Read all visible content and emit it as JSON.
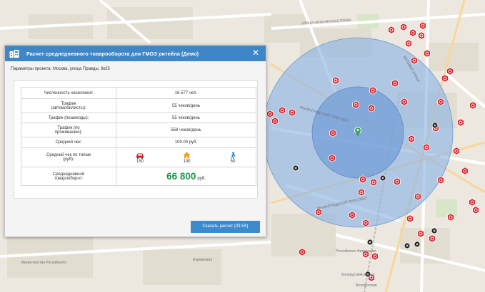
{
  "dialog": {
    "title": "Расчет среднедневного товарооборота для ГМОЗ ритейла (Демо)",
    "close_symbol": "✕",
    "params": "Параметры проекта: Москва, улица Правды, 8к35",
    "download_label": "Скачать расчет (33.5X)"
  },
  "table": {
    "population_label": "Численность населения:",
    "population_value": "16 577 чел.",
    "traffic_cars_label_1": "Трафик",
    "traffic_cars_label_2": "(автомобилисты):",
    "traffic_cars_value": "55 чеков/день",
    "traffic_ped_label": "Трафик (пешеходы):",
    "traffic_ped_value": "55 чеков/день",
    "traffic_res_label_1": "Трафик (по",
    "traffic_res_label_2": "проживанию):",
    "traffic_res_value": "558 чеков/день",
    "avg_check_label": "Средний чек:",
    "avg_check_value": "100.00 руб.",
    "avg_check_types_label_1": "Средний чек по типам",
    "avg_check_types_label_2": "(руб):",
    "type_car_value": "150",
    "type_home_value": "100",
    "type_walk_value": "50",
    "turnover_label_1": "Среднедневной",
    "turnover_label_2": "товарооборот:",
    "turnover_value": "66 800",
    "turnover_unit": "руб."
  },
  "map_labels": {
    "street_1": "УЛИЦА НИЖНЯЯ МАСЛОВКА",
    "street_2": "БЕГОВАЯ УЛИЦА",
    "street_3": "ЛЕНИНГРАДСКИЙ ПРОСПЕКТ",
    "street_4": "ЛЕНИНГРАДСКИЙ ПРОСПЕКТ",
    "poi_1": "Белорусский вокзал",
    "poi_2": "Аэровокзал",
    "poi_3": "Российского Федерации",
    "poi_4": "Министерство Российского",
    "metro": "Белорусская"
  },
  "colors": {
    "accent": "#3f86c6",
    "turnover": "#1f9549",
    "marker_red": "#d6202a",
    "circle_outer": "#8fb6e3",
    "circle_inner": "#6b9ad6"
  },
  "icons": {
    "app": "calculator-icon",
    "close": "close-icon",
    "car": "car-icon",
    "home": "home-icon",
    "walk": "pedestrian-icon",
    "center": "location-pin-icon"
  }
}
